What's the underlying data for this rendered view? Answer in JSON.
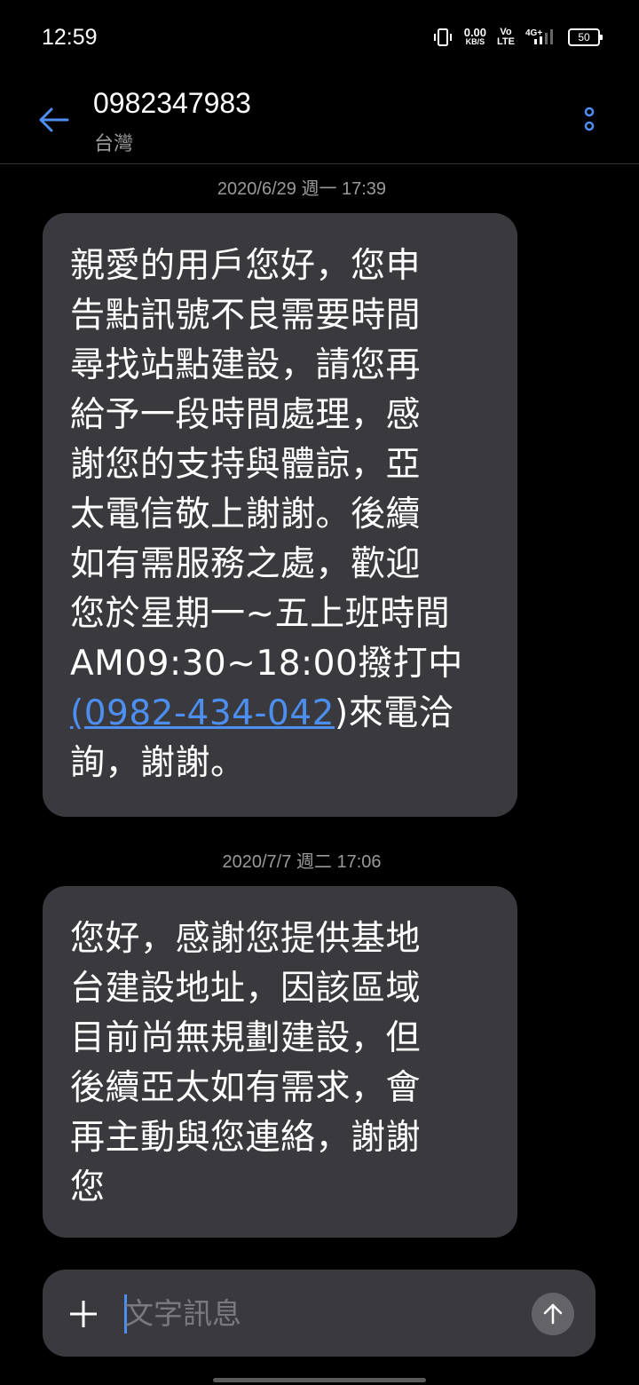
{
  "status_bar": {
    "time": "12:59",
    "net_speed_value": "0.00",
    "net_speed_unit": "KB/S",
    "volte_top": "Vo",
    "volte_bottom": "LTE",
    "network_type": "4G+",
    "battery": "50"
  },
  "header": {
    "contact_number": "0982347983",
    "contact_region": "台灣",
    "back_icon": "arrow-left-icon",
    "more_icon": "more-vertical-icon"
  },
  "messages": [
    {
      "timestamp": "2020/6/29 週一 17:39",
      "text_before_link": "親愛的用戶您好，您申\n告點訊號不良需要時間\n尋找站點建設，請您再\n給予一段時間處理，感\n謝您的支持與體諒，亞\n太電信敬上謝謝。後續\n如有需服務之處，歡迎\n您於星期一~五上班時間\nAM09:30~18:00撥打中\n",
      "link": "(0982-434-042",
      "text_after_link": ")來電洽\n詢，謝謝。"
    },
    {
      "timestamp": "2020/7/7 週二 17:06",
      "text": "您好，感謝您提供基地\n台建設地址，因該區域\n目前尚無規劃建設，但\n後續亞太如有需求，會\n再主動與您連絡，謝謝\n您"
    }
  ],
  "composer": {
    "placeholder": "文字訊息",
    "add_icon": "plus-icon",
    "send_icon": "arrow-up-icon"
  },
  "colors": {
    "background": "#000000",
    "bubble": "#3a3a3e",
    "accent": "#4d8ff0",
    "muted_text": "#9a9a9a"
  }
}
